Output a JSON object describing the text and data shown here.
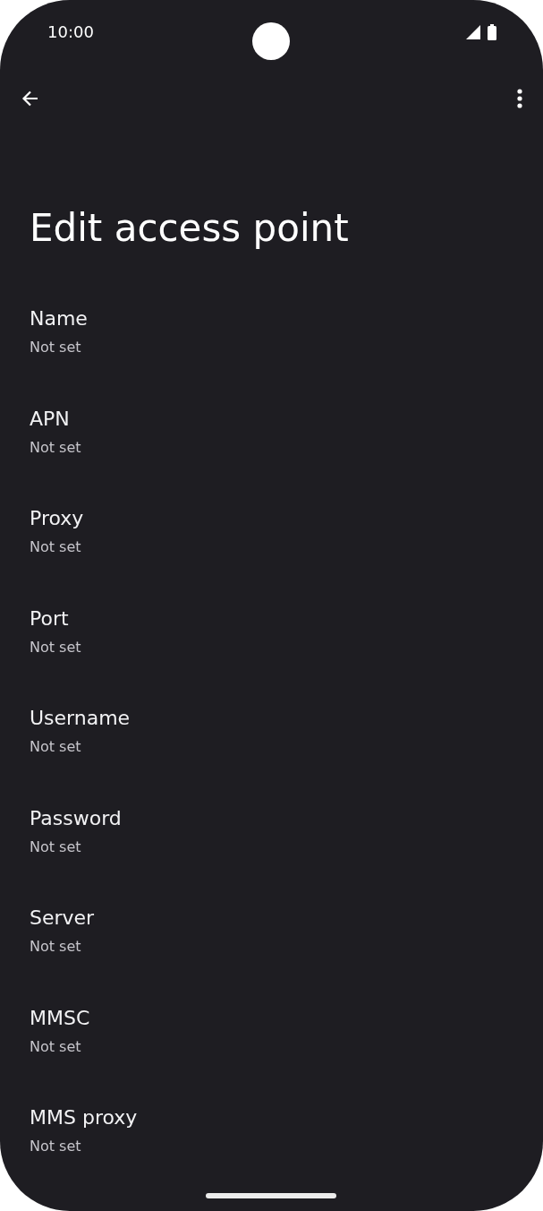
{
  "status_bar": {
    "time": "10:00"
  },
  "title": "Edit access point",
  "items": [
    {
      "label": "Name",
      "value": "Not set"
    },
    {
      "label": "APN",
      "value": "Not set"
    },
    {
      "label": "Proxy",
      "value": "Not set"
    },
    {
      "label": "Port",
      "value": "Not set"
    },
    {
      "label": "Username",
      "value": "Not set"
    },
    {
      "label": "Password",
      "value": "Not set"
    },
    {
      "label": "Server",
      "value": "Not set"
    },
    {
      "label": "MMSC",
      "value": "Not set"
    },
    {
      "label": "MMS proxy",
      "value": "Not set"
    }
  ]
}
